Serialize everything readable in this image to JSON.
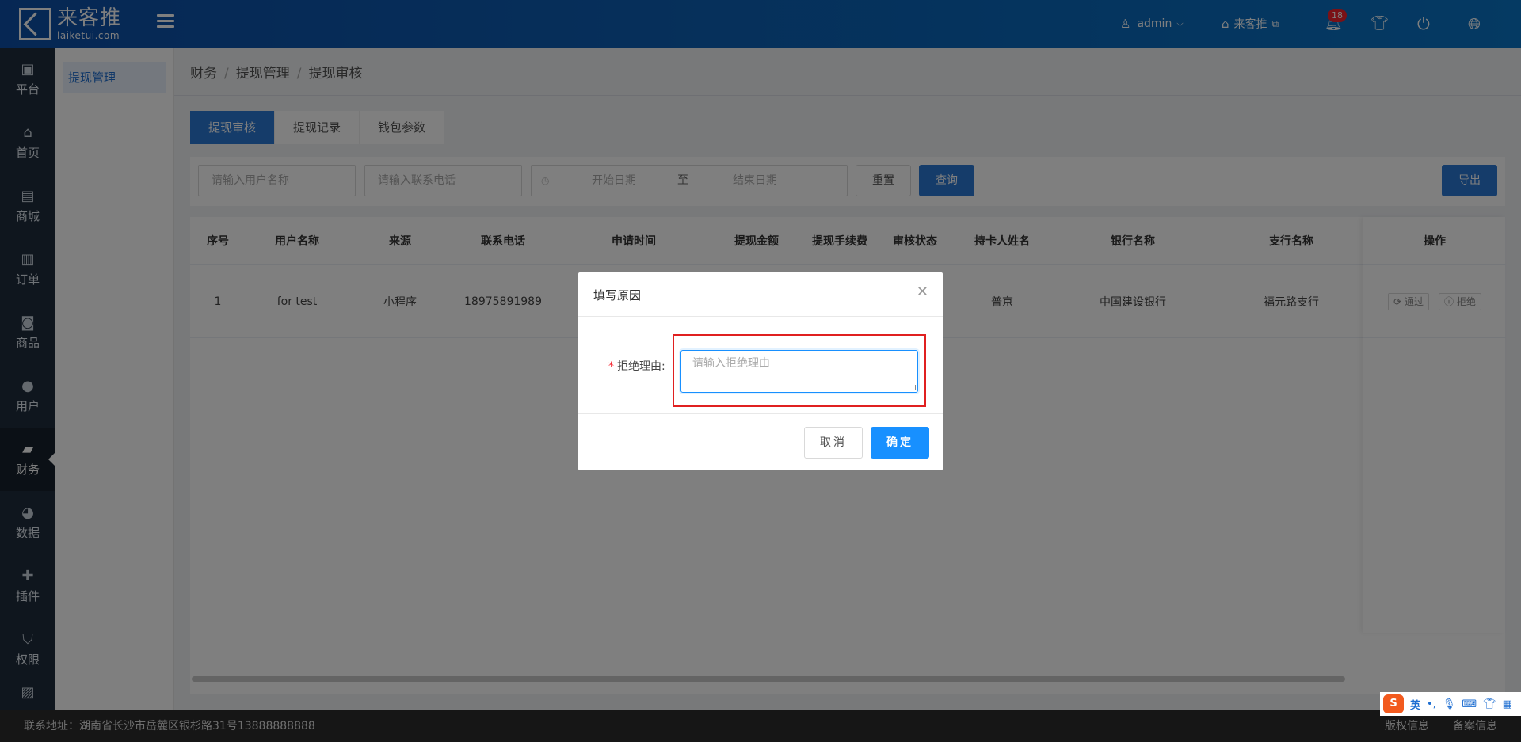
{
  "header": {
    "logo_text": "来客推",
    "logo_sub": "laiketui.com",
    "user": "admin",
    "store": "来客推",
    "notifications_count": "18"
  },
  "sidebar": {
    "items": [
      {
        "label": "平台",
        "icon": "platform-icon"
      },
      {
        "label": "首页",
        "icon": "home-icon"
      },
      {
        "label": "商城",
        "icon": "mall-icon"
      },
      {
        "label": "订单",
        "icon": "order-icon"
      },
      {
        "label": "商品",
        "icon": "product-icon"
      },
      {
        "label": "用户",
        "icon": "user-icon"
      },
      {
        "label": "财务",
        "icon": "wallet-icon"
      },
      {
        "label": "数据",
        "icon": "chart-pie-icon"
      },
      {
        "label": "插件",
        "icon": "puzzle-icon"
      },
      {
        "label": "权限",
        "icon": "shield-icon"
      }
    ]
  },
  "submenu": {
    "item": "提现管理"
  },
  "breadcrumb": [
    "财务",
    "提现管理",
    "提现审核"
  ],
  "tabs": [
    "提现审核",
    "提现记录",
    "钱包参数"
  ],
  "filter": {
    "username_placeholder": "请输入用户名称",
    "phone_placeholder": "请输入联系电话",
    "start_date": "开始日期",
    "to": "至",
    "end_date": "结束日期",
    "reset": "重置",
    "query": "查询",
    "export": "导出"
  },
  "table": {
    "headers": [
      "序号",
      "用户名称",
      "来源",
      "联系电话",
      "申请时间",
      "提现金额",
      "提现手续费",
      "审核状态",
      "持卡人姓名",
      "银行名称",
      "支行名称",
      "操作"
    ],
    "row": {
      "index": "1",
      "username": "for test",
      "source": "小程序",
      "phone": "18975891989",
      "holder": "普京",
      "bank": "中国建设银行",
      "branch": "福元路支行",
      "approve": "通过",
      "reject": "拒绝"
    }
  },
  "modal": {
    "title": "填写原因",
    "label": "拒绝理由:",
    "placeholder": "请输入拒绝理由",
    "cancel": "取消",
    "ok": "确定"
  },
  "footer": {
    "address": "联系地址：湖南省长沙市岳麓区银杉路31号13888888888",
    "copyright": "版权信息",
    "record": "备案信息"
  },
  "ime": {
    "mode": "英"
  },
  "colors": {
    "header": "#0a6cc2",
    "primary": "#2b78d4",
    "sidebar": "#1f2d3d",
    "danger": "#e02020"
  }
}
